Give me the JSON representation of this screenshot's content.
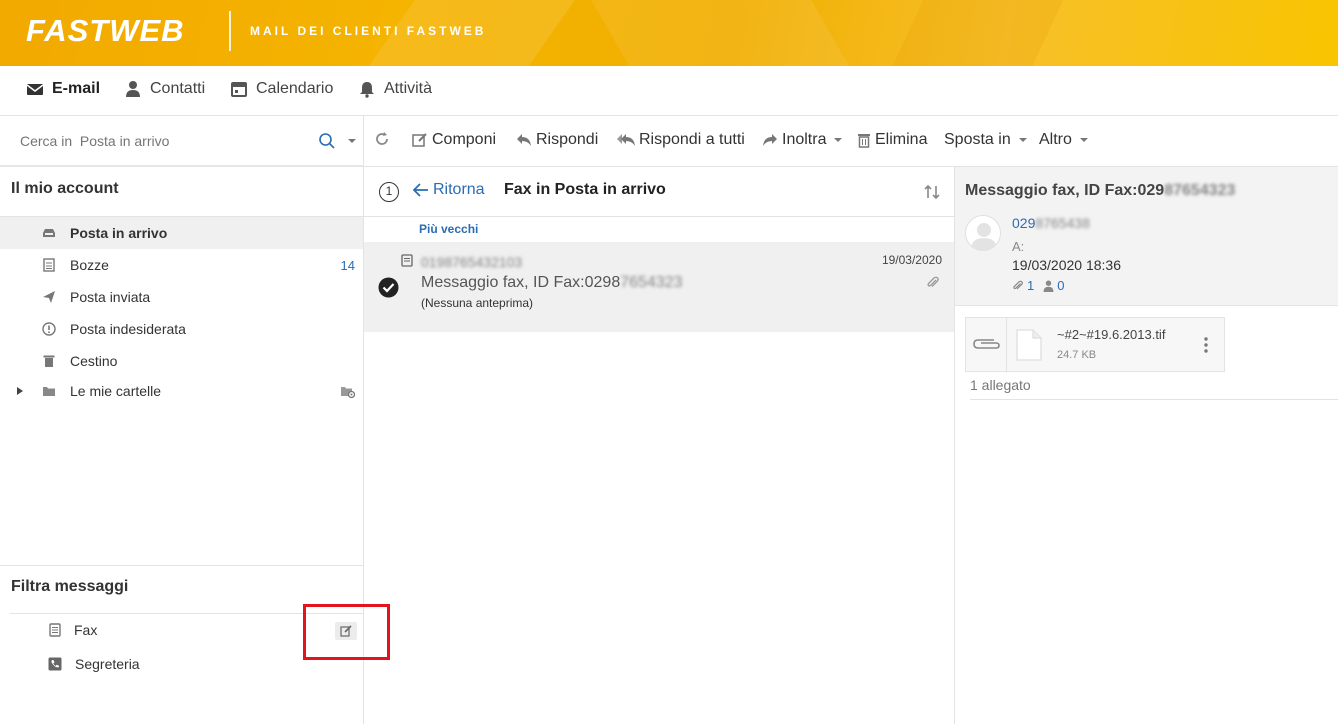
{
  "header": {
    "logo": "FASTWEB",
    "subtitle": "MAIL DEI CLIENTI FASTWEB"
  },
  "nav": {
    "email": "E-mail",
    "contacts": "Contatti",
    "calendar": "Calendario",
    "tasks": "Attività"
  },
  "search": {
    "placeholder": "Cerca in  Posta in arrivo"
  },
  "toolbar": {
    "compose": "Componi",
    "reply": "Rispondi",
    "reply_all": "Rispondi a tutti",
    "forward": "Inoltra",
    "delete": "Elimina",
    "move": "Sposta in",
    "more": "Altro"
  },
  "sidebar": {
    "account_title": "Il mio account",
    "folders": [
      {
        "label": "Posta in arrivo",
        "count": ""
      },
      {
        "label": "Bozze",
        "count": "14"
      },
      {
        "label": "Posta inviata",
        "count": ""
      },
      {
        "label": "Posta indesiderata",
        "count": ""
      },
      {
        "label": "Cestino",
        "count": ""
      },
      {
        "label": "Le mie cartelle",
        "count": ""
      }
    ],
    "filter_title": "Filtra messaggi",
    "filters": [
      {
        "label": "Fax"
      },
      {
        "label": "Segreteria"
      }
    ]
  },
  "list": {
    "back": "Ritorna",
    "title": "Fax in Posta in arrivo",
    "step": "1",
    "group": "Più vecchi",
    "message": {
      "sender": "0198765432103",
      "date": "19/03/2020",
      "subject_prefix": "Messaggio fax, ID Fax:0298",
      "subject_blur": "7654323",
      "preview": "(Nessuna anteprima)"
    }
  },
  "preview": {
    "subject_prefix": "Messaggio fax, ID Fax:029",
    "subject_blur": "87654323",
    "from_prefix": "029",
    "from_blur": "8765438",
    "to_label": "A:",
    "datetime": "19/03/2020 18:36",
    "attachments_count": "1",
    "people_count": "0",
    "attachment": {
      "name": "~#2~#19.6.2013.tif",
      "size": "24.7 KB"
    },
    "attachment_summary": "1 allegato"
  },
  "colors": {
    "brand": "#f5b400",
    "link": "#2a6db3",
    "highlight": "#e3141b"
  }
}
